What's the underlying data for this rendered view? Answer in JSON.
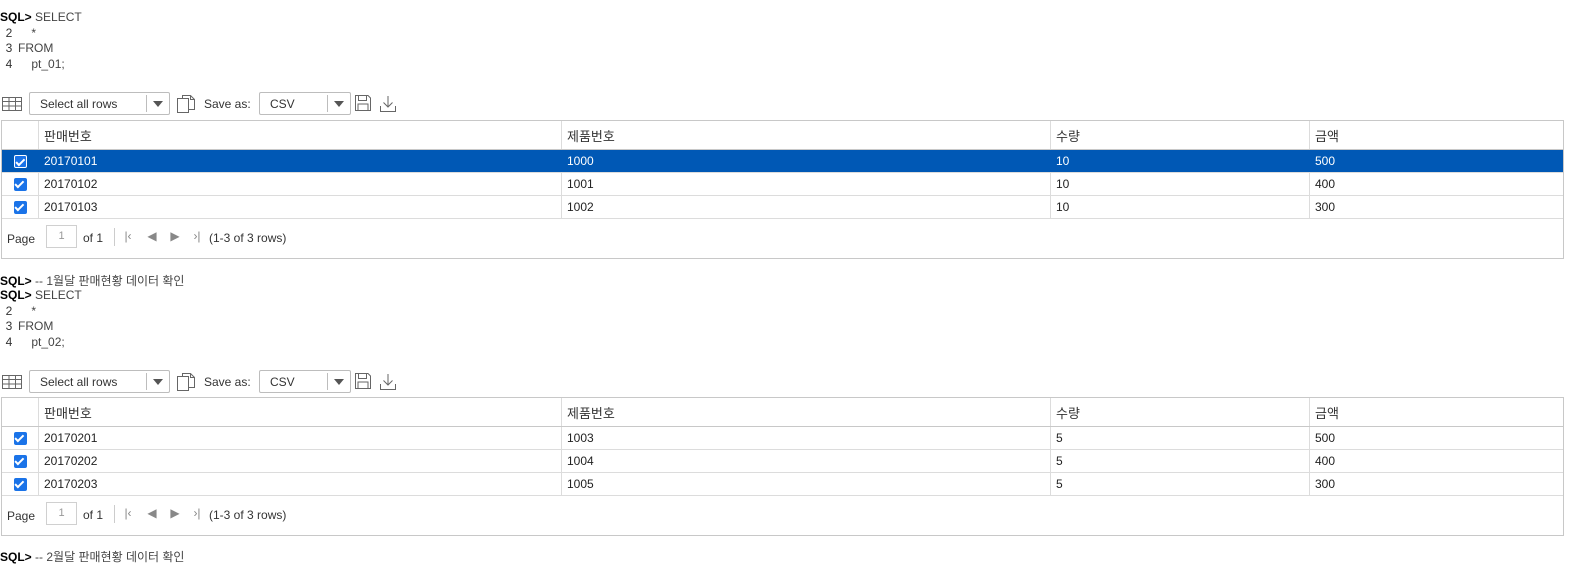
{
  "prompt": "SQL>",
  "statements": [
    {
      "lines": [
        {
          "num": "",
          "text": "SELECT"
        },
        {
          "num": "2",
          "text": "    *"
        },
        {
          "num": "3",
          "text": "FROM"
        },
        {
          "num": "4",
          "text": "    pt_01;"
        }
      ]
    },
    {
      "lines": [
        {
          "num": "",
          "text": "SELECT"
        },
        {
          "num": "2",
          "text": "    *"
        },
        {
          "num": "3",
          "text": "FROM"
        },
        {
          "num": "4",
          "text": "    pt_02;"
        }
      ]
    }
  ],
  "comments": [
    "-- 1월달 판매현황 데이터 확인",
    "-- 2월달 판매현황 데이터 확인"
  ],
  "toolbar": {
    "select_rows": "Select all rows",
    "save_as_label": "Save as:",
    "format": "CSV"
  },
  "columns": [
    "판매번호",
    "제품번호",
    "수량",
    "금액"
  ],
  "results": [
    {
      "rows": [
        [
          "20170101",
          "1000",
          "10",
          "500"
        ],
        [
          "20170102",
          "1001",
          "10",
          "400"
        ],
        [
          "20170103",
          "1002",
          "10",
          "300"
        ]
      ],
      "selected_row": 0
    },
    {
      "rows": [
        [
          "20170201",
          "1003",
          "5",
          "500"
        ],
        [
          "20170202",
          "1004",
          "5",
          "400"
        ],
        [
          "20170203",
          "1005",
          "5",
          "300"
        ]
      ],
      "selected_row": -1
    }
  ],
  "pager": {
    "label": "Page",
    "current": "1",
    "of_text": "of 1",
    "info": "(1-3 of 3 rows)"
  },
  "colors": {
    "selected_row": "#0058b5",
    "checkbox": "#1a73e8"
  },
  "icons": [
    "grid-icon",
    "copy-icon",
    "floppy-disk-icon",
    "download-icon",
    "first-page-icon",
    "prev-page-icon",
    "next-page-icon",
    "last-page-icon"
  ]
}
